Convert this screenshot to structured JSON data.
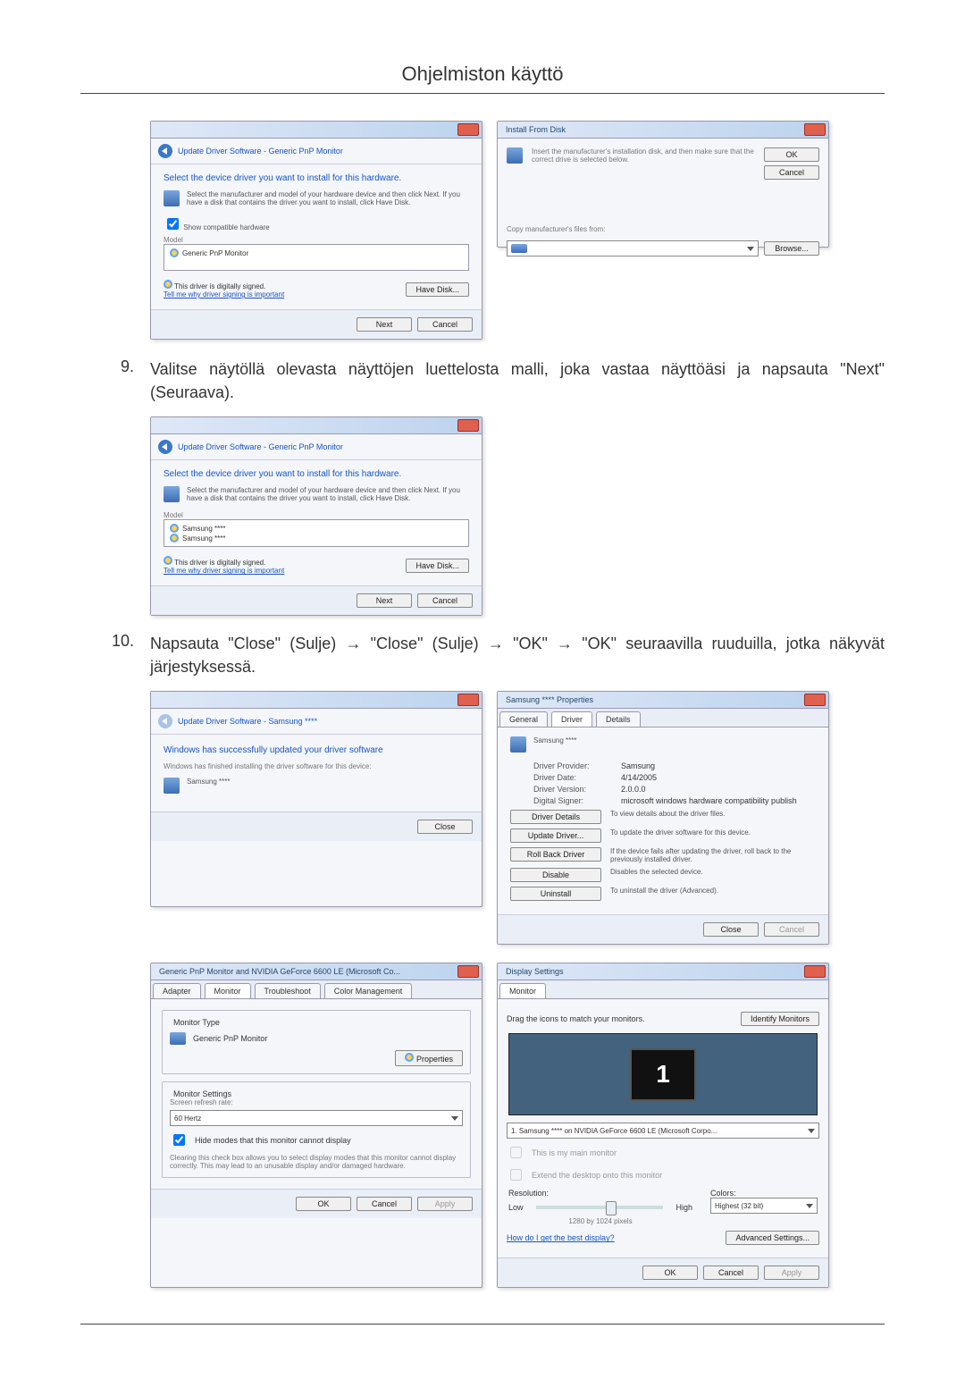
{
  "page_title": "Ohjelmiston käyttö",
  "step9": {
    "num": "9.",
    "text": "Valitse näytöllä olevasta näyttöjen luettelosta malli, joka vastaa näyttöäsi ja napsauta \"Next\" (Seuraava)."
  },
  "step10": {
    "num": "10.",
    "text": "Napsauta \"Close\" (Sulje) → \"Close\" (Sulje) → \"OK\" → \"OK\" seuraavilla ruuduilla, jotka näkyvät järjestyksessä."
  },
  "dlg_update1": {
    "crumb": "Update Driver Software - Generic PnP Monitor",
    "heading": "Select the device driver you want to install for this hardware.",
    "inst": "Select the manufacturer and model of your hardware device and then click Next. If you have a disk that contains the driver you want to install, click Have Disk.",
    "checkbox": "Show compatible hardware",
    "model_label": "Model",
    "model_item": "Generic PnP Monitor",
    "signed": "This driver is digitally signed.",
    "why_link": "Tell me why driver signing is important",
    "have_disk": "Have Disk...",
    "next": "Next",
    "cancel": "Cancel"
  },
  "dlg_install_from_disk": {
    "title": "Install From Disk",
    "inst": "Insert the manufacturer's installation disk, and then make sure that the correct drive is selected below.",
    "ok": "OK",
    "cancel": "Cancel",
    "copy_label": "Copy manufacturer's files from:",
    "browse": "Browse..."
  },
  "dlg_update2": {
    "crumb": "Update Driver Software - Generic PnP Monitor",
    "heading": "Select the device driver you want to install for this hardware.",
    "inst": "Select the manufacturer and model of your hardware device and then click Next. If you have a disk that contains the driver you want to install, click Have Disk.",
    "model_label": "Model",
    "model_items": [
      "Samsung ****",
      "Samsung ****"
    ],
    "signed": "This driver is digitally signed.",
    "why_link": "Tell me why driver signing is important",
    "have_disk": "Have Disk...",
    "next": "Next",
    "cancel": "Cancel"
  },
  "dlg_success": {
    "crumb": "Update Driver Software - Samsung ****",
    "heading": "Windows has successfully updated your driver software",
    "sub": "Windows has finished installing the driver software for this device:",
    "device": "Samsung ****",
    "close": "Close"
  },
  "dlg_props": {
    "title": "Samsung **** Properties",
    "tabs": [
      "General",
      "Driver",
      "Details"
    ],
    "device": "Samsung ****",
    "fields": {
      "provider_label": "Driver Provider:",
      "provider_value": "Samsung",
      "date_label": "Driver Date:",
      "date_value": "4/14/2005",
      "version_label": "Driver Version:",
      "version_value": "2.0.0.0",
      "signer_label": "Digital Signer:",
      "signer_value": "microsoft windows hardware compatibility publish"
    },
    "btns": {
      "details": "Driver Details",
      "details_desc": "To view details about the driver files.",
      "update": "Update Driver...",
      "update_desc": "To update the driver software for this device.",
      "rollback": "Roll Back Driver",
      "rollback_desc": "If the device fails after updating the driver, roll back to the previously installed driver.",
      "disable": "Disable",
      "disable_desc": "Disables the selected device.",
      "uninstall": "Uninstall",
      "uninstall_desc": "To uninstall the driver (Advanced)."
    },
    "close": "Close",
    "cancel": "Cancel"
  },
  "dlg_monitor": {
    "title": "Generic PnP Monitor and NVIDIA GeForce 6600 LE (Microsoft Co...",
    "tabs": [
      "Adapter",
      "Monitor",
      "Troubleshoot",
      "Color Management"
    ],
    "type_group": "Monitor Type",
    "type_value": "Generic PnP Monitor",
    "properties_btn": "Properties",
    "settings_group": "Monitor Settings",
    "refresh_label": "Screen refresh rate:",
    "refresh_value": "60 Hertz",
    "hide_check": "Hide modes that this monitor cannot display",
    "hide_desc": "Clearing this check box allows you to select display modes that this monitor cannot display correctly. This may lead to an unusable display and/or damaged hardware.",
    "ok": "OK",
    "cancel": "Cancel",
    "apply": "Apply"
  },
  "dlg_display": {
    "title": "Display Settings",
    "tab": "Monitor",
    "drag_label": "Drag the icons to match your monitors.",
    "identify": "Identify Monitors",
    "monitor_number": "1",
    "monitor_combo": "1. Samsung **** on NVIDIA GeForce 6600 LE (Microsoft Corpo...",
    "main_check": "This is my main monitor",
    "extend_check": "Extend the desktop onto this monitor",
    "resolution_label": "Resolution:",
    "low": "Low",
    "high": "High",
    "resolution_value": "1280 by 1024 pixels",
    "colors_label": "Colors:",
    "colors_value": "Highest (32 bit)",
    "best_link": "How do I get the best display?",
    "advanced": "Advanced Settings...",
    "ok": "OK",
    "cancel": "Cancel",
    "apply": "Apply"
  }
}
